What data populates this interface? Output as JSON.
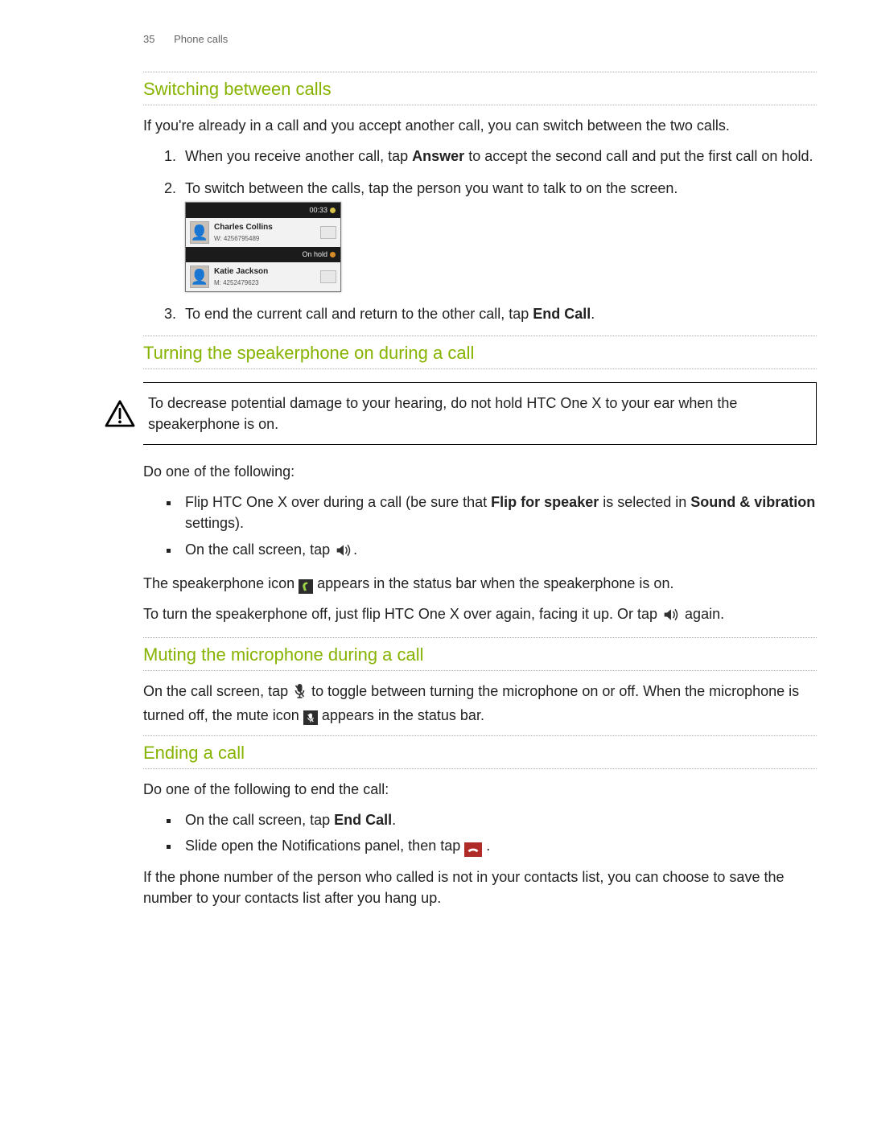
{
  "header": {
    "page_number": "35",
    "section": "Phone calls"
  },
  "switching": {
    "title": "Switching between calls",
    "intro": "If you're already in a call and you accept another call, you can switch between the two calls.",
    "step1_pre": "When you receive another call, tap ",
    "step1_bold": "Answer",
    "step1_post": " to accept the second call and put the first call on hold.",
    "step2": "To switch between the calls, tap the person you want to talk to on the screen.",
    "step3_pre": "To end the current call and return to the other call, tap ",
    "step3_bold": "End Call",
    "step3_post": ".",
    "shot": {
      "timer": "00:33",
      "hold_label": "On hold",
      "calls": [
        {
          "name": "Charles Collins",
          "number": "W: 4256795489"
        },
        {
          "name": "Katie Jackson",
          "number": "M: 4252479623"
        }
      ]
    }
  },
  "speakerphone": {
    "title": "Turning the speakerphone on during a call",
    "caution": "To decrease potential damage to your hearing, do not hold HTC One X to your ear when the speakerphone is on.",
    "lead": "Do one of the following:",
    "b1_pre": "Flip HTC One X over during a call (be sure that ",
    "b1_bold1": "Flip for speaker",
    "b1_mid": " is selected in ",
    "b1_bold2": "Sound & vibration",
    "b1_post": " settings).",
    "b2": "On the call screen, tap ",
    "status_pre": "The speakerphone icon ",
    "status_post": " appears in the status bar when the speakerphone is on.",
    "off_pre": "To turn the speakerphone off, just flip HTC One X over again, facing it up. Or tap ",
    "off_post": " again."
  },
  "muting": {
    "title": "Muting the microphone during a call",
    "p_pre": "On the call screen, tap ",
    "p_mid": " to toggle between turning the microphone on or off. When the microphone is turned off, the mute icon ",
    "p_post": " appears in the status bar."
  },
  "ending": {
    "title": "Ending a call",
    "lead": "Do one of the following to end the call:",
    "b1_pre": "On the call screen, tap ",
    "b1_bold": "End Call",
    "b1_post": ".",
    "b2_pre": "Slide open the Notifications panel, then tap ",
    "b2_post": ".",
    "foot": "If the phone number of the person who called is not in your contacts list, you can choose to save the number to your contacts list after you hang up."
  }
}
